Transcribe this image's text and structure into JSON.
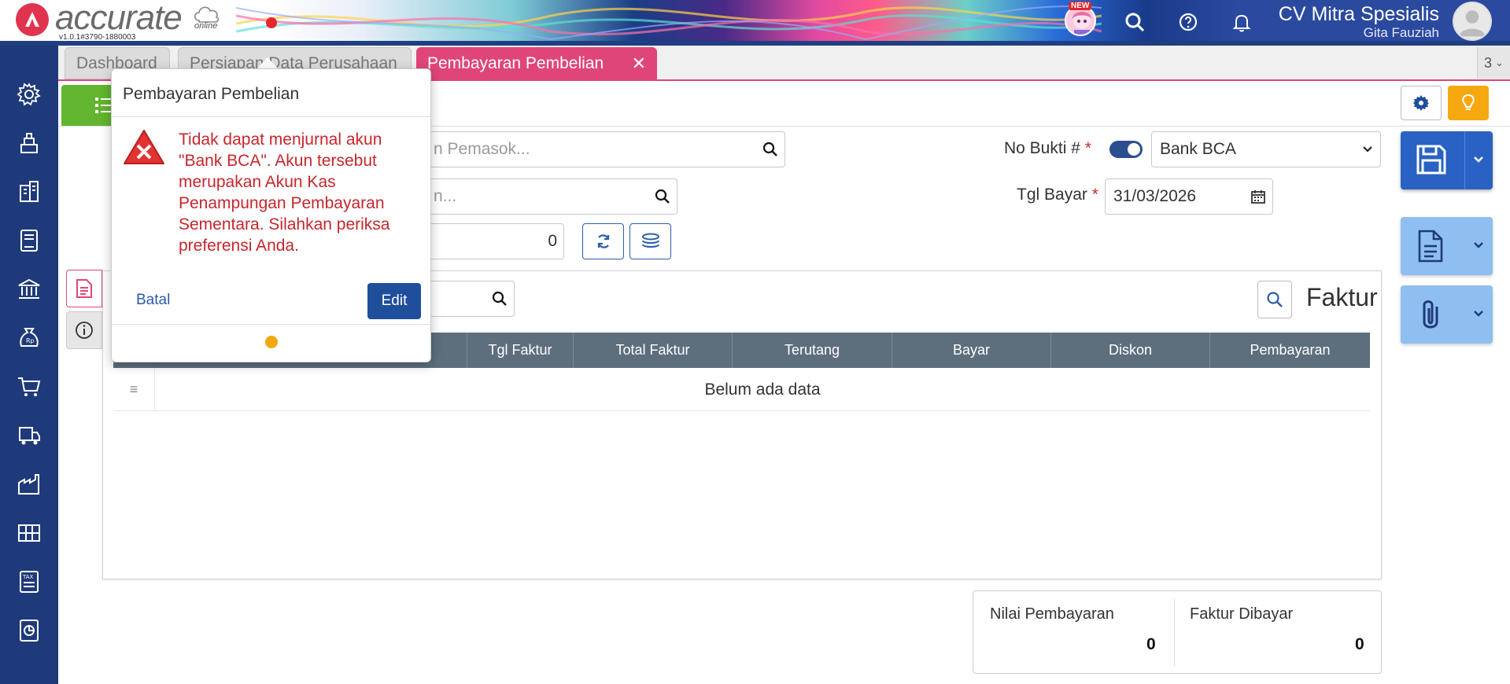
{
  "header": {
    "logo_text": "accurate",
    "logo_sub": "online",
    "version": "v1.0.1#3790-1880003",
    "new_badge": "NEW",
    "company": "CV Mitra Spesialis",
    "user": "Gita Fauziah"
  },
  "tabs": [
    {
      "label": "Dashboard"
    },
    {
      "label": "Persiapan Data Perusahaan"
    },
    {
      "label": "Pembayaran Pembelian"
    }
  ],
  "tab_count": "3",
  "form": {
    "supplier_placeholder": "n Pemasok...",
    "search2_placeholder": "n...",
    "amount_value": "0",
    "no_bukti_label": "No Bukti #",
    "bank_value": "Bank BCA",
    "tgl_bayar_label": "Tgl Bayar",
    "tgl_bayar_value": "31/03/2026",
    "required_mark": "*"
  },
  "faktur": {
    "title": "Faktur",
    "columns": [
      "Tgl Faktur",
      "Total Faktur",
      "Terutang",
      "Bayar",
      "Diskon",
      "Pembayaran"
    ],
    "empty_text": "Belum ada data"
  },
  "summary": {
    "nilai_label": "Nilai Pembayaran",
    "nilai_value": "0",
    "faktur_label": "Faktur Dibayar",
    "faktur_value": "0"
  },
  "popup": {
    "title": "Pembayaran Pembelian",
    "message": "Tidak dapat menjurnal akun \"Bank BCA\". Akun tersebut merupakan Akun Kas Penampungan Pembayaran Sementara. Silahkan periksa preferensi Anda.",
    "cancel_label": "Batal",
    "edit_label": "Edit"
  },
  "colors": {
    "accent_pink": "#e0457a",
    "sidebar": "#1f3a7a",
    "primary_blue": "#2962c2",
    "error_red": "#c7262b",
    "green": "#62b52e",
    "orange": "#f5a80f"
  },
  "icons": [
    "settings-icon",
    "inventory-icon",
    "company-icon",
    "ledger-icon",
    "bank-icon",
    "money-bag-icon",
    "cart-icon",
    "delivery-icon",
    "factory-icon",
    "warehouse-icon",
    "tax-icon",
    "report-icon"
  ]
}
